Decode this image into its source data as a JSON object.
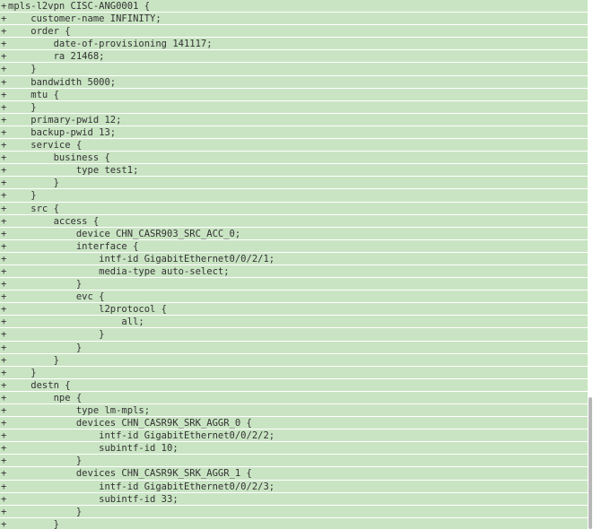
{
  "diff": {
    "marker": "+",
    "lines": [
      "mpls-l2vpn CISC-ANG0001 {",
      "    customer-name INFINITY;",
      "    order {",
      "        date-of-provisioning 141117;",
      "        ra 21468;",
      "    }",
      "    bandwidth 5000;",
      "    mtu {",
      "    }",
      "    primary-pwid 12;",
      "    backup-pwid 13;",
      "    service {",
      "        business {",
      "            type test1;",
      "        }",
      "    }",
      "    src {",
      "        access {",
      "            device CHN_CASR903_SRC_ACC_0;",
      "            interface {",
      "                intf-id GigabitEthernet0/0/2/1;",
      "                media-type auto-select;",
      "            }",
      "            evc {",
      "                l2protocol {",
      "                    all;",
      "                }",
      "            }",
      "        }",
      "    }",
      "    destn {",
      "        npe {",
      "            type lm-mpls;",
      "            devices CHN_CASR9K_SRK_AGGR_0 {",
      "                intf-id GigabitEthernet0/0/2/2;",
      "                subintf-id 10;",
      "            }",
      "            devices CHN_CASR9K_SRK_AGGR_1 {",
      "                intf-id GigabitEthernet0/0/2/3;",
      "                subintf-id 33;",
      "            }",
      "        }"
    ]
  }
}
